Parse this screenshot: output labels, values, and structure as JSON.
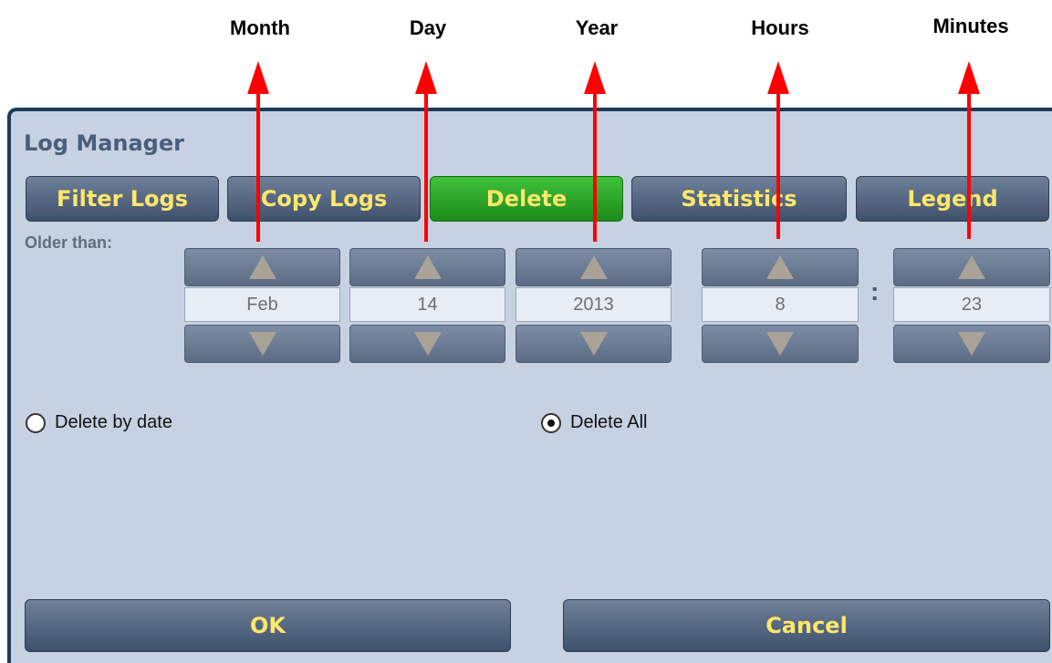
{
  "callouts": {
    "month": "Month",
    "day": "Day",
    "year": "Year",
    "hours": "Hours",
    "minutes": "Minutes"
  },
  "window": {
    "title": "Log Manager"
  },
  "tabs": [
    {
      "label": "Filter Logs"
    },
    {
      "label": "Copy Logs"
    },
    {
      "label": "Delete",
      "active": true
    },
    {
      "label": "Statistics"
    },
    {
      "label": "Legend"
    }
  ],
  "delete_form": {
    "older_than_label": "Older than:",
    "month": "Feb",
    "day": "14",
    "year": "2013",
    "hours": "8",
    "time_separator": ":",
    "minutes": "23"
  },
  "options": {
    "delete_by_date": {
      "label": "Delete by date",
      "selected": false
    },
    "delete_all": {
      "label": "Delete All",
      "selected": true
    }
  },
  "actions": {
    "ok": "OK",
    "cancel": "Cancel"
  },
  "colors": {
    "panel_bg": "#c6d2e2",
    "button_text": "#ffe76a",
    "active_tab": "#2aa827",
    "callout_arrow": "#ff0000"
  },
  "icons": {
    "increment": "triangle-up-icon",
    "decrement": "triangle-down-icon"
  }
}
